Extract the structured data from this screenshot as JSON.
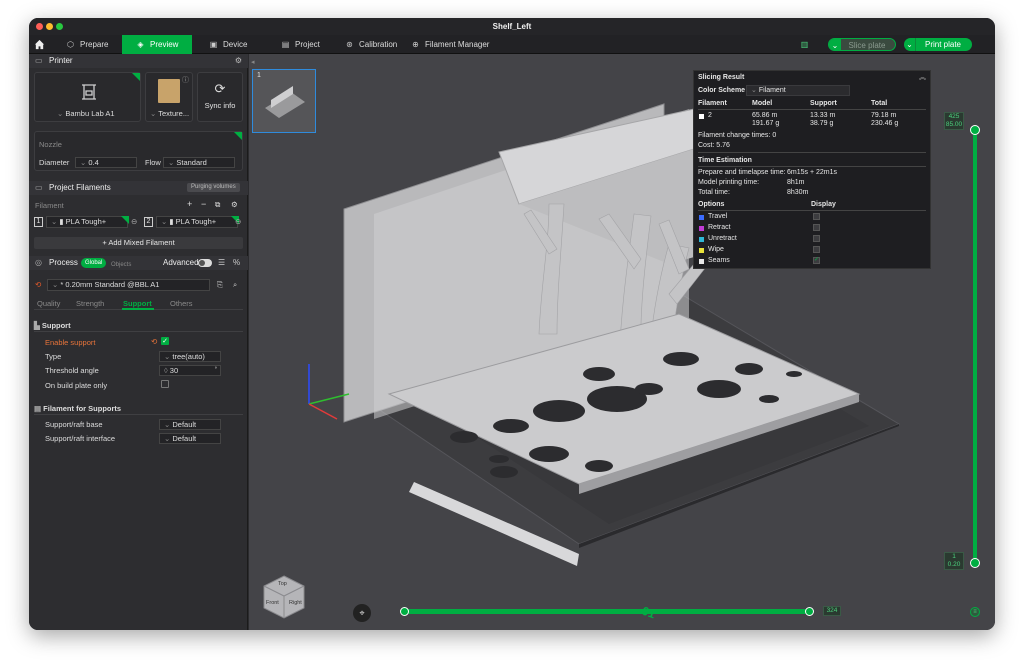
{
  "window": {
    "title": "Shelf_Left"
  },
  "nav": {
    "prepare": "Prepare",
    "preview": "Preview",
    "device": "Device",
    "project": "Project",
    "calibration": "Calibration",
    "filament_manager": "Filament Manager",
    "slice_plate": "Slice plate",
    "print_plate": "Print plate"
  },
  "printer": {
    "section": "Printer",
    "printer_name": "Bambu Lab A1",
    "plate_name": "Texture...",
    "sync_info": "Sync info",
    "nozzle_label": "Nozzle",
    "diameter_label": "Diameter",
    "diameter_value": "0.4",
    "flow_label": "Flow",
    "flow_value": "Standard"
  },
  "filaments": {
    "section": "Project Filaments",
    "purging_btn": "Purging volumes",
    "filament_label": "Filament",
    "items": [
      {
        "index": "1",
        "name": "PLA Tough+",
        "color": "#ffffff"
      },
      {
        "index": "2",
        "name": "PLA Tough+",
        "color": "#ffffff"
      }
    ],
    "add_mixed": "+ Add Mixed Filament"
  },
  "process": {
    "section": "Process",
    "global_tab": "Global",
    "objects_tab": "Objects",
    "advanced_label": "Advanced",
    "profile": "* 0.20mm Standard @BBL A1",
    "tabs": [
      "Quality",
      "Strength",
      "Support",
      "Others"
    ],
    "active_tab": "Support"
  },
  "support": {
    "heading": "Support",
    "enable_label": "Enable support",
    "enable_checked": true,
    "type_label": "Type",
    "type_value": "tree(auto)",
    "threshold_label": "Threshold angle",
    "threshold_value": "30",
    "threshold_unit": "°",
    "build_plate_only_label": "On build plate only",
    "build_plate_only_checked": false
  },
  "filament_supports": {
    "heading": "Filament for Supports",
    "base_label": "Support/raft base",
    "base_value": "Default",
    "interface_label": "Support/raft interface",
    "interface_value": "Default"
  },
  "plate_thumb": {
    "number": "1"
  },
  "slicing_result": {
    "title": "Slicing Result",
    "color_scheme_label": "Color Scheme",
    "color_scheme_value": "Filament",
    "columns": [
      "Filament",
      "Model",
      "Support",
      "Total"
    ],
    "row": {
      "filament": "2",
      "model_len": "65.86 m",
      "model_wt": "191.67 g",
      "support_len": "13.33 m",
      "support_wt": "38.79 g",
      "total_len": "79.18 m",
      "total_wt": "230.46 g"
    },
    "change_times_label": "Filament change times:",
    "change_times_value": "0",
    "cost_label": "Cost:",
    "cost_value": "5.76",
    "time_heading": "Time Estimation",
    "prepare_label": "Prepare and timelapse time:",
    "prepare_value": "6m15s + 22m1s",
    "model_time_label": "Model printing time:",
    "model_time_value": "8h1m",
    "total_time_label": "Total time:",
    "total_time_value": "8h30m",
    "options_heading": "Options",
    "display_heading": "Display",
    "options": [
      {
        "name": "Travel",
        "color": "#3b6cff",
        "display": false
      },
      {
        "name": "Retract",
        "color": "#c23bd6",
        "display": false
      },
      {
        "name": "Unretract",
        "color": "#2fb8d8",
        "display": false
      },
      {
        "name": "Wipe",
        "color": "#e8e23a",
        "display": false
      },
      {
        "name": "Seams",
        "color": "#e8e8e8",
        "display": true
      }
    ]
  },
  "layer_slider": {
    "top_layer": "425",
    "top_height": "85.00",
    "bottom_layer": "1",
    "bottom_height": "0.20",
    "top_fraction": 1.0
  },
  "move_slider": {
    "value": "324",
    "fraction": 1.0
  },
  "nav_cube": {
    "top": "Top",
    "front": "Front",
    "right": "Right"
  },
  "plate_label": {
    "number": "01"
  },
  "colors": {
    "accent": "#00ae42",
    "panel": "#1e1e21",
    "viewport": "#444448",
    "model": "#c7c7c7"
  }
}
